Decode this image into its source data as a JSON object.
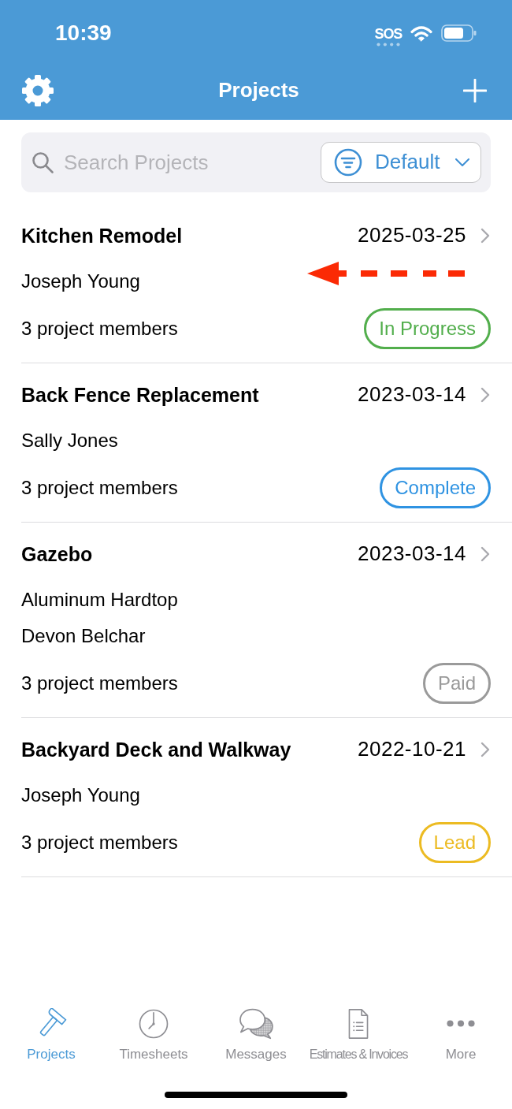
{
  "status_bar": {
    "time": "10:39",
    "carrier": "SOS"
  },
  "nav_bar": {
    "title": "Projects"
  },
  "search": {
    "placeholder": "Search Projects",
    "sort_button": "Default"
  },
  "projects": [
    {
      "title": "Kitchen Remodel",
      "date": "2025-03-25",
      "details": [
        "Joseph Young"
      ],
      "members": "3 project members",
      "status": {
        "label": "In Progress",
        "color": "#52ae4c"
      },
      "pointer_arrow": true
    },
    {
      "title": "Back Fence Replacement",
      "date": "2023-03-14",
      "details": [
        "Sally Jones"
      ],
      "members": "3 project members",
      "status": {
        "label": "Complete",
        "color": "#2f93e2"
      },
      "pointer_arrow": false
    },
    {
      "title": "Gazebo",
      "date": "2023-03-14",
      "details": [
        "Aluminum Hardtop",
        "Devon Belchar"
      ],
      "members": "3 project members",
      "status": {
        "label": "Paid",
        "color": "#9a9a9a"
      },
      "pointer_arrow": false
    },
    {
      "title": "Backyard Deck and Walkway",
      "date": "2022-10-21",
      "details": [
        "Joseph Young"
      ],
      "members": "3 project members",
      "status": {
        "label": "Lead",
        "color": "#ecbb22"
      },
      "pointer_arrow": false
    }
  ],
  "tab_bar": [
    {
      "label": "Projects",
      "kind": "projects",
      "selected": true
    },
    {
      "label": "Timesheets",
      "kind": "timesheets",
      "selected": false
    },
    {
      "label": "Messages",
      "kind": "messages",
      "selected": false
    },
    {
      "label": "Estimates & Invoices",
      "kind": "estimates",
      "selected": false
    },
    {
      "label": "More",
      "kind": "more",
      "selected": false
    }
  ]
}
